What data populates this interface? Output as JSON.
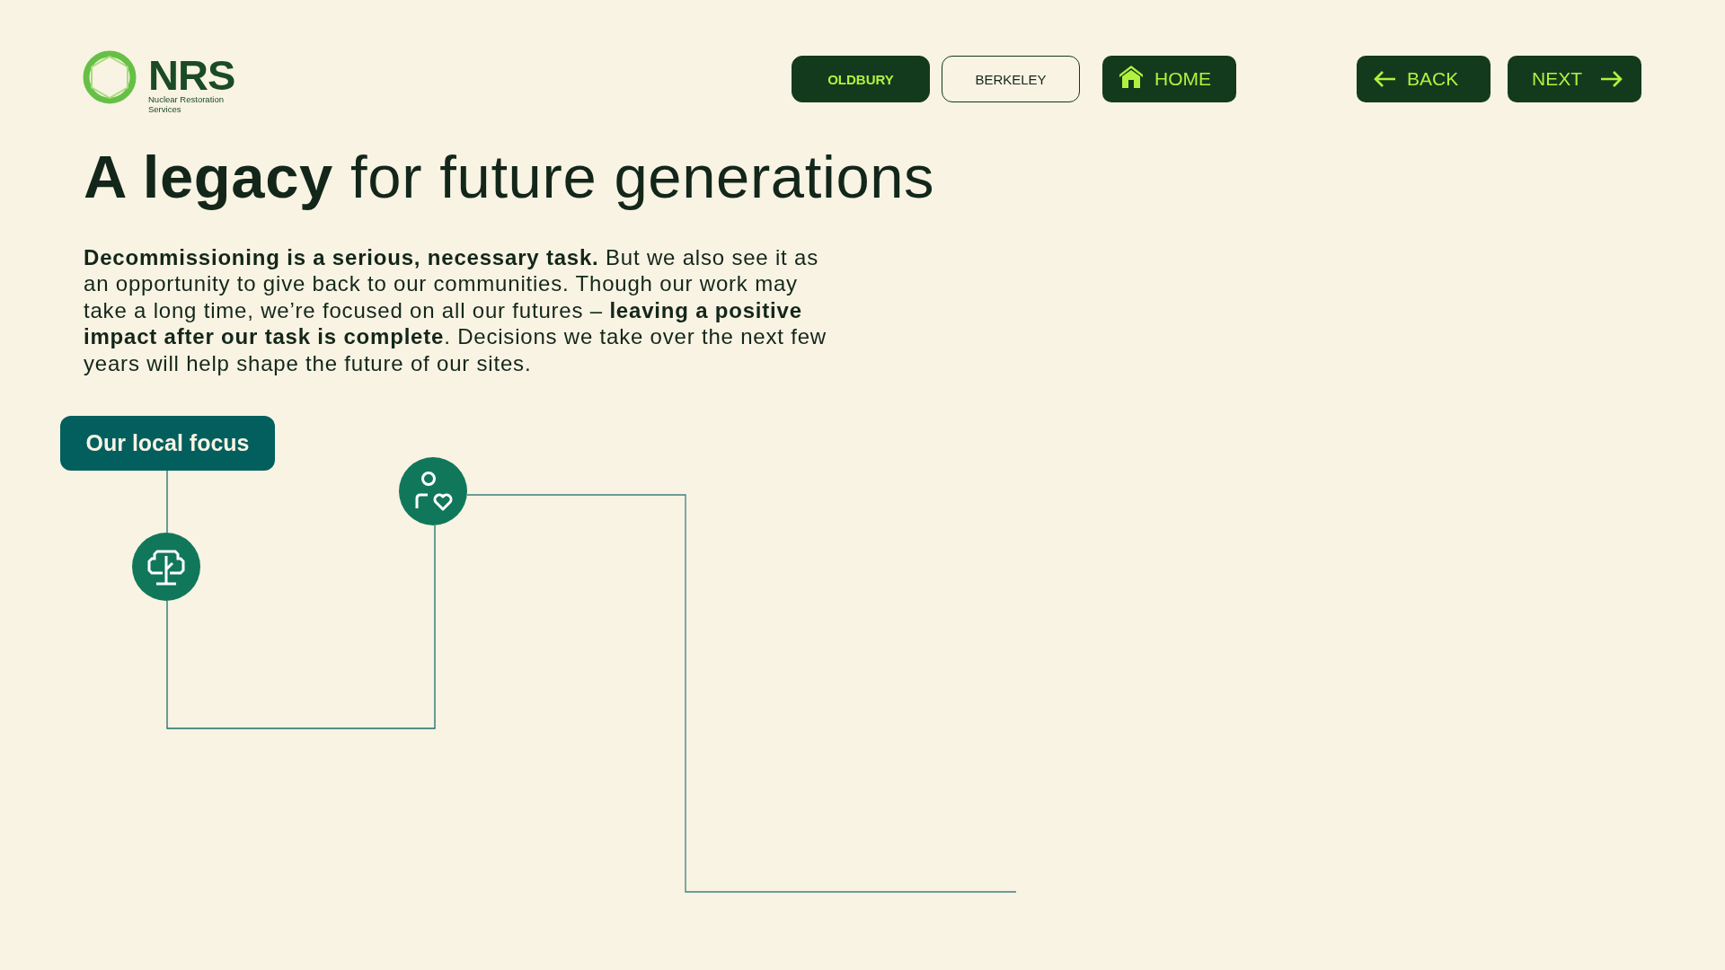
{
  "logo": {
    "wordmark": "NRS",
    "subtitle": "Nuclear Restoration Services"
  },
  "site_tabs": [
    {
      "label": "OLDBURY",
      "selected": true
    },
    {
      "label": "BERKELEY",
      "selected": false
    }
  ],
  "nav_buttons": [
    {
      "kind": "home",
      "label": "HOME"
    },
    {
      "kind": "back",
      "label": "BACK"
    },
    {
      "kind": "next",
      "label": "NEXT"
    }
  ],
  "heading": "**A legacy** for future generations",
  "intro": "**Decommissioning is a serious, necessary task.** But we also see it as an opportunity to give back to our communities. Though our work may take a long time, we’re focused on all our futures – **leaving a positive impact after our task is complete**. Decisions we take over the next few years will help shape the future of our sites.",
  "focus_button": {
    "label": "Our local focus"
  }
}
